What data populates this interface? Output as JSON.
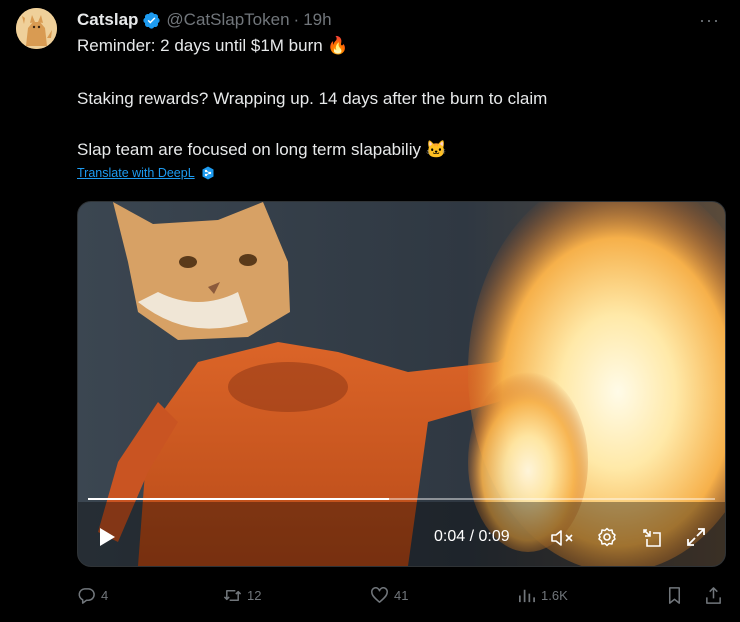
{
  "author": {
    "name": "Catslap",
    "handle": "@CatSlapToken",
    "separator": "·",
    "time": "19h"
  },
  "more_label": "···",
  "post": {
    "line1": "Reminder: 2 days until $1M burn 🔥",
    "line2": "Staking rewards? Wrapping up. 14 days after the burn to claim",
    "line3": "Slap team are focused on long term slapabiliy 🐱",
    "translate": "Translate with DeepL"
  },
  "video": {
    "current": "0:04",
    "divider": "/",
    "duration": "0:09",
    "timecode": "0:04 / 0:09",
    "progress": 0.48
  },
  "actions": {
    "replies": "4",
    "reposts": "12",
    "likes": "41",
    "views": "1.6K"
  },
  "colors": {
    "background": "#000000",
    "text": "#e7e9ea",
    "muted": "#71767b",
    "accent": "#1d9bf0"
  }
}
